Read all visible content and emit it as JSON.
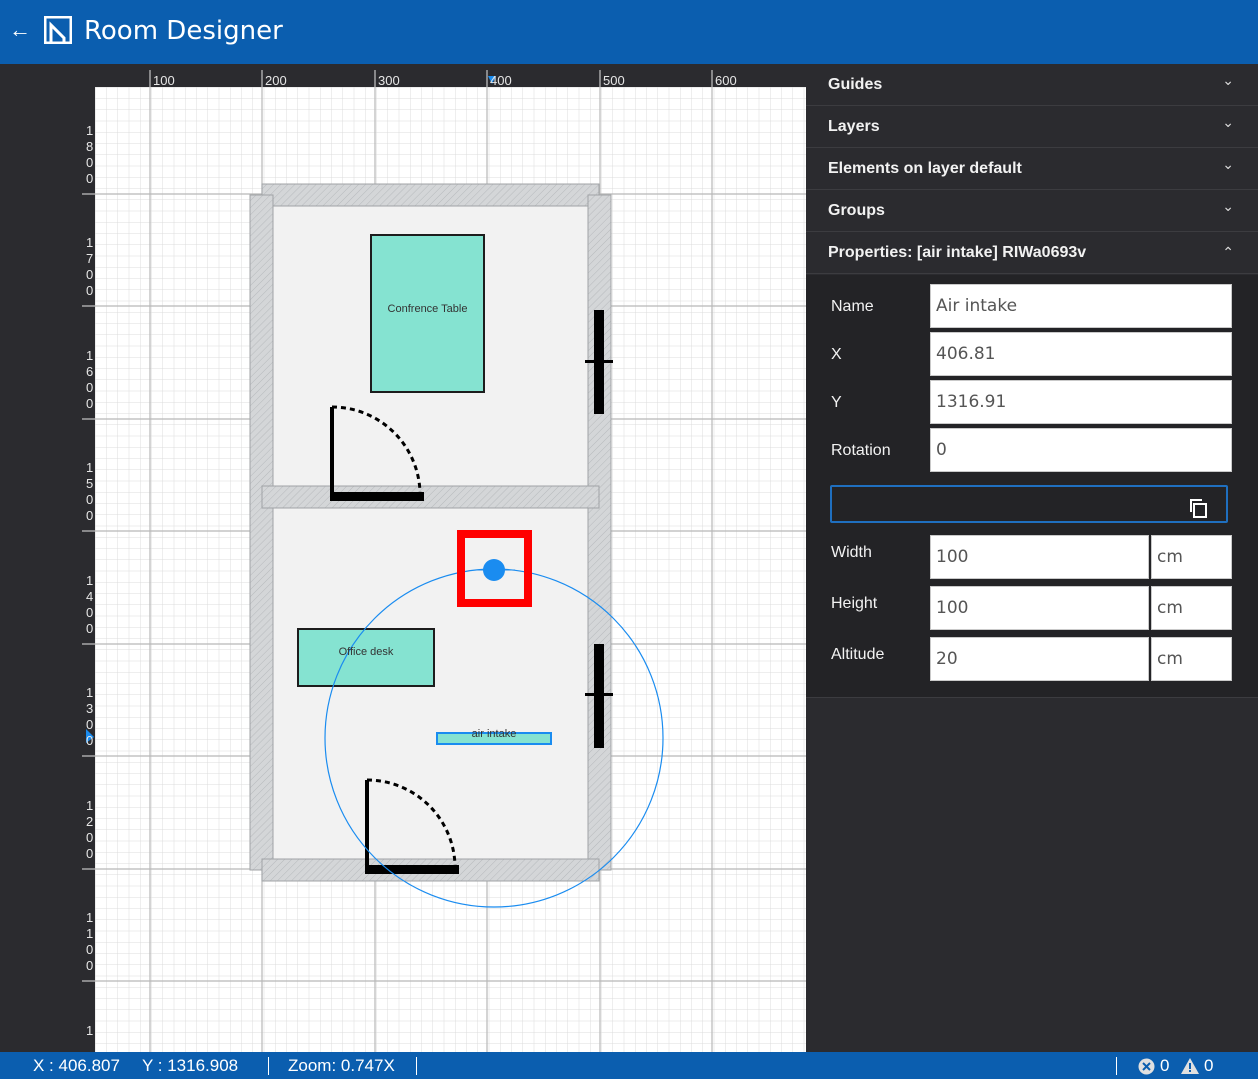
{
  "app": {
    "title": "Room Designer"
  },
  "ruler": {
    "top": [
      "100",
      "200",
      "300",
      "400",
      "500",
      "600"
    ],
    "left": [
      "1800",
      "1700",
      "1600",
      "1500",
      "1400",
      "1300",
      "1200",
      "1100",
      "1"
    ]
  },
  "canvas": {
    "furniture": [
      {
        "label": "Confrence Table"
      },
      {
        "label": "Office desk"
      },
      {
        "label": "air intake"
      }
    ]
  },
  "panel": {
    "sections": [
      "Guides",
      "Layers",
      "Elements on layer default",
      "Groups"
    ],
    "properties_title": "Properties: [air intake] RIWa0693v",
    "fields": {
      "name": {
        "label": "Name",
        "value": "Air intake"
      },
      "x": {
        "label": "X",
        "value": "406.81"
      },
      "y": {
        "label": "Y",
        "value": "1316.91"
      },
      "rotation": {
        "label": "Rotation",
        "value": "0"
      },
      "width": {
        "label": "Width",
        "value": "100",
        "unit": "cm"
      },
      "height": {
        "label": "Height",
        "value": "100",
        "unit": "cm"
      },
      "altitude": {
        "label": "Altitude",
        "value": "20",
        "unit": "cm"
      }
    }
  },
  "status": {
    "x": "X : 406.807",
    "y": "Y : 1316.908",
    "zoom": "Zoom: 0.747X",
    "errors": "0",
    "warnings": "0"
  },
  "icons": [
    "back-arrow-icon",
    "logo-icon",
    "new-file-icon",
    "save-icon",
    "add-icon",
    "pointer-icon",
    "undo-icon",
    "chevron-down-icon",
    "chevron-up-icon",
    "copy-icon",
    "error-icon",
    "warning-icon"
  ],
  "colors": {
    "header": "#0b5eaf",
    "furniture": "#85e3d1",
    "selection": "#1a8cf0",
    "highlight": "#ff0000"
  }
}
